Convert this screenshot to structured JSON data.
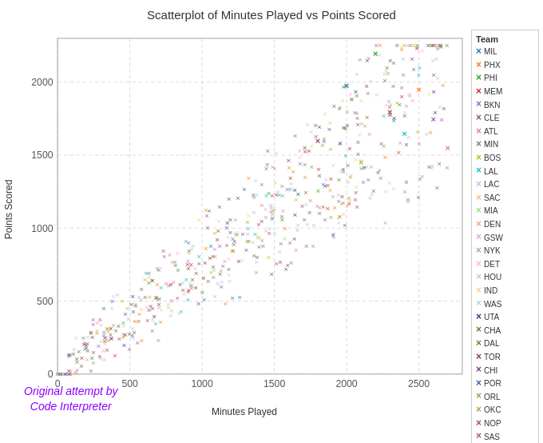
{
  "title": "Scatterplot of Minutes Played vs Points Scored",
  "xLabel": "Minutes Played",
  "yLabel": "Points Scored",
  "watermark": {
    "line1": "Original attempt by",
    "line2": "Code Interpreter"
  },
  "legend": {
    "title": "Team",
    "items": [
      {
        "label": "MIL",
        "color": "#1f77b4"
      },
      {
        "label": "PHX",
        "color": "#ff7f0e"
      },
      {
        "label": "PHI",
        "color": "#2ca02c"
      },
      {
        "label": "MEM",
        "color": "#d62728"
      },
      {
        "label": "BKN",
        "color": "#9467bd"
      },
      {
        "label": "CLE",
        "color": "#8c564b"
      },
      {
        "label": "ATL",
        "color": "#e377c2"
      },
      {
        "label": "MIN",
        "color": "#7f7f7f"
      },
      {
        "label": "BOS",
        "color": "#bcbd22"
      },
      {
        "label": "LAL",
        "color": "#17becf"
      },
      {
        "label": "LAC",
        "color": "#aec7e8"
      },
      {
        "label": "SAC",
        "color": "#ffbb78"
      },
      {
        "label": "MIA",
        "color": "#98df8a"
      },
      {
        "label": "DEN",
        "color": "#ff9896"
      },
      {
        "label": "GSW",
        "color": "#c5b0d5"
      },
      {
        "label": "NYK",
        "color": "#c49c94"
      },
      {
        "label": "DET",
        "color": "#f7b6d2"
      },
      {
        "label": "HOU",
        "color": "#c7c7c7"
      },
      {
        "label": "IND",
        "color": "#dbdb8d"
      },
      {
        "label": "WAS",
        "color": "#9edae5"
      },
      {
        "label": "UTA",
        "color": "#393b79"
      },
      {
        "label": "CHA",
        "color": "#637939"
      },
      {
        "label": "DAL",
        "color": "#8c6d31"
      },
      {
        "label": "TOR",
        "color": "#843c39"
      },
      {
        "label": "CHI",
        "color": "#7b4173"
      },
      {
        "label": "POR",
        "color": "#5254a3"
      },
      {
        "label": "ORL",
        "color": "#8ca252"
      },
      {
        "label": "OKC",
        "color": "#bd9e39"
      },
      {
        "label": "NOP",
        "color": "#ad494a"
      },
      {
        "label": "SAS",
        "color": "#a55194"
      }
    ]
  },
  "axes": {
    "xMin": 0,
    "xMax": 2800,
    "yMin": 0,
    "yMax": 2300,
    "xTicks": [
      0,
      500,
      1000,
      1500,
      2000,
      2500
    ],
    "yTicks": [
      0,
      500,
      1000,
      1500,
      2000
    ]
  }
}
